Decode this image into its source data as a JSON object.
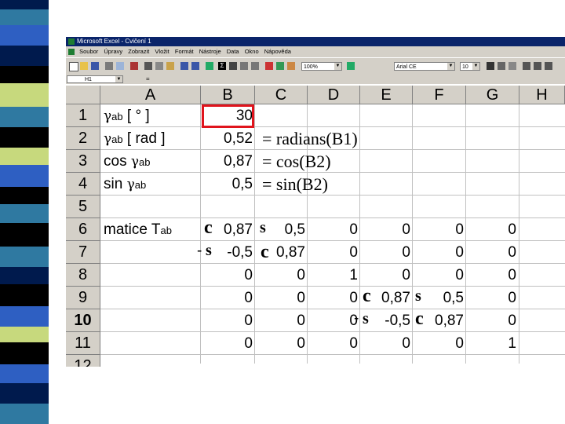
{
  "window": {
    "title": "Microsoft Excel - Cvičení 1"
  },
  "menu": [
    "Soubor",
    "Úpravy",
    "Zobrazit",
    "Vložit",
    "Formát",
    "Nástroje",
    "Data",
    "Okno",
    "Nápověda"
  ],
  "toolbar": {
    "zoom": "100%",
    "font": "Arial CE",
    "font_size": "10"
  },
  "formula_bar": {
    "name_box": "H1",
    "fx": "="
  },
  "columns": [
    "A",
    "B",
    "C",
    "D",
    "E",
    "F",
    "G",
    "H"
  ],
  "rows": [
    "1",
    "2",
    "3",
    "4",
    "5",
    "6",
    "7",
    "8",
    "9",
    "10",
    "11",
    "12"
  ],
  "cells": {
    "a1_gamma": "γ",
    "a1_sub": "ab",
    "a1_rest": "[ ° ]",
    "a2_gamma": "γ",
    "a2_sub": "ab",
    "a2_rest": "[ rad ]",
    "a3_pre": "cos ",
    "a3_gamma": "γ",
    "a3_sub": "ab",
    "a4_pre": "sin ",
    "a4_gamma": "γ",
    "a4_sub": "ab",
    "a6_text": "matice T",
    "a6_sub": "ab",
    "b1": "30",
    "b2": "0,52",
    "b3": "0,87",
    "b4": "0,5",
    "b6": "0,87",
    "c6": "0,5",
    "d6": "0",
    "e6": "0",
    "f6": "0",
    "g6": "0",
    "b7": "-0,5",
    "c7": "0,87",
    "d7": "0",
    "e7": "0",
    "f7": "0",
    "g7": "0",
    "b8": "0",
    "c8": "0",
    "d8": "1",
    "e8": "0",
    "f8": "0",
    "g8": "0",
    "b9": "0",
    "c9": "0",
    "d9": "0",
    "e9": "0,87",
    "f9": "0,5",
    "g9": "0",
    "b10": "0",
    "c10": "0",
    "d10": "0",
    "e10": "-0,5",
    "f10": "0,87",
    "g10": "0",
    "b11": "0",
    "c11": "0",
    "d11": "0",
    "e11": "0",
    "f11": "0",
    "g11": "1"
  },
  "formulas": {
    "f2": "= radians(B1)",
    "f3": "= cos(B2)",
    "f4": "= sin(B2)"
  },
  "symbols": {
    "c": "c",
    "s": "s",
    "minus": "-"
  },
  "colors": {
    "selection": "#e0141c",
    "stripe": [
      "#2e5fc2",
      "#c7d97d",
      "#000000",
      "#2f79a1",
      "#ffffff",
      "#001a4d"
    ]
  }
}
